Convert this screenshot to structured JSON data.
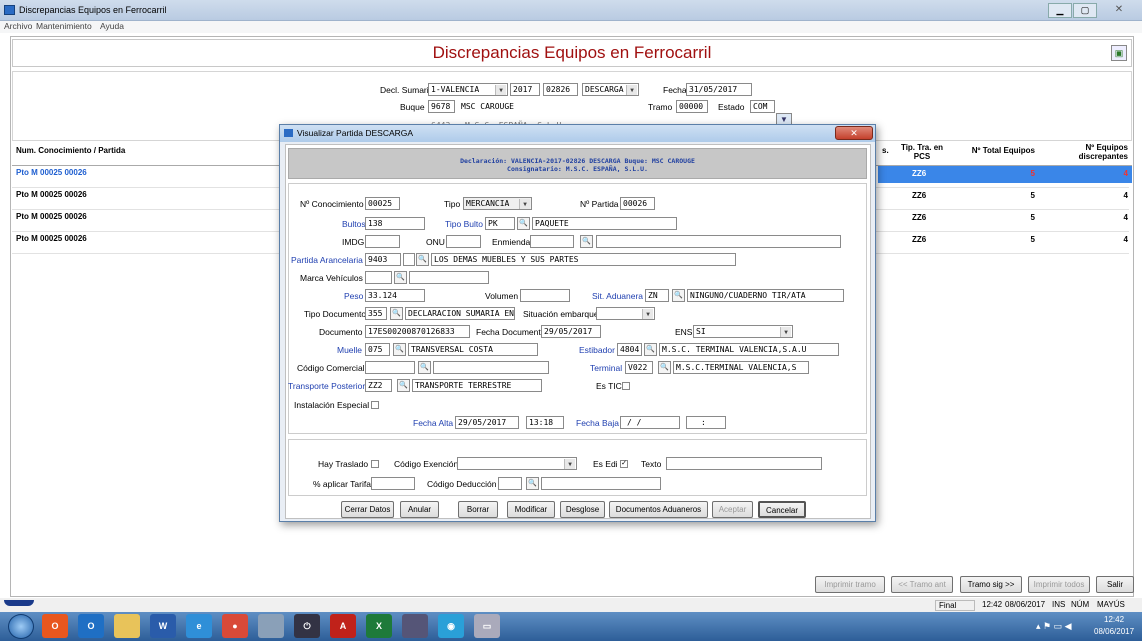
{
  "window": {
    "title": "Discrepancias Equipos en Ferrocarril"
  },
  "menu": [
    "Archivo",
    "Mantenimiento",
    "Ayuda"
  ],
  "page_title": "Discrepancias Equipos en Ferrocarril",
  "header": {
    "decl_label": "Decl. Sumaria",
    "decl_value": "1-VALENCIA",
    "year": "2017",
    "number": "02826",
    "op": "DESCARGA",
    "fecha_label": "Fecha",
    "fecha": "31/05/2017",
    "buque_label": "Buque",
    "buque_code": "9678",
    "buque_name": "MSC CAROUGE",
    "tramo_label": "Tramo",
    "tramo": "00000",
    "estado_label": "Estado",
    "estado": "COM",
    "cons_code": "6443",
    "cons_name": "M.S.C. ESPAÑA, S.L.U."
  },
  "table": {
    "col_partida": "Num. Conocimiento / Partida",
    "col_s": "s.",
    "col_tip": "Tip. Tra. en PCS",
    "col_total": "Nº Total Equipos",
    "col_disc": "Nº Equipos discrepantes",
    "rows": [
      {
        "partida": "Pto M 00025 00026",
        "tip": "ZZ6",
        "total": "5",
        "disc": "4"
      },
      {
        "partida": "Pto M 00025 00026",
        "tip": "ZZ6",
        "total": "5",
        "disc": "4"
      },
      {
        "partida": "Pto M 00025 00026",
        "tip": "ZZ6",
        "total": "5",
        "disc": "4"
      },
      {
        "partida": "Pto M 00025 00026",
        "tip": "ZZ6",
        "total": "5",
        "disc": "4"
      }
    ]
  },
  "bottom_buttons": {
    "imprimir_tramo": "Imprimir tramo",
    "tramo_ant": "<< Tramo ant",
    "tramo_sig": "Tramo sig >>",
    "imprimir_todos": "Imprimir todos",
    "salir": "Salir"
  },
  "status": {
    "final": "Final",
    "time": "12:42",
    "date": "08/06/2017",
    "ins": "INS",
    "num": "NÚM",
    "mayus": "MAYÚS"
  },
  "dialog": {
    "title": "Visualizar Partida DESCARGA",
    "banner_line1": "Declaración: VALENCIA-2017-02826 DESCARGA    Buque: MSC CAROUGE",
    "banner_line2": "Consignatario: M.S.C. ESPAÑA, S.L.U.",
    "labels": {
      "conocimiento": "Nº Conocimiento",
      "tipo": "Tipo",
      "partida": "Nº Partida",
      "bultos": "Bultos",
      "tipo_bulto": "Tipo Bulto",
      "imdg": "IMDG",
      "onu": "ONU",
      "enmienda": "Enmienda",
      "arancelaria": "Partida Arancelaria",
      "marca": "Marca Vehículos",
      "peso": "Peso",
      "volumen": "Volumen",
      "sit_aduanera": "Sit. Aduanera",
      "tipo_doc": "Tipo Documento",
      "sit_embarque": "Situación embarque",
      "documento": "Documento",
      "fecha_doc": "Fecha Documento",
      "ens": "ENS",
      "muelle": "Muelle",
      "estibador": "Estibador",
      "cod_comercial": "Código Comercial",
      "terminal": "Terminal",
      "transporte": "Transporte Posterior",
      "es_tic": "Es TIC",
      "instalacion": "Instalación Especial",
      "fecha_alta": "Fecha Alta",
      "fecha_baja": "Fecha Baja",
      "traslado": "Hay Traslado",
      "cod_exencion": "Código Exención",
      "es_edi": "Es Edi",
      "texto": "Texto",
      "aplicar_tarifa": "% aplicar Tarifa",
      "cod_deduccion": "Código Deducción"
    },
    "values": {
      "conocimiento": "00025",
      "tipo": "MERCANCIA",
      "partida": "00026",
      "bultos": "138",
      "tipo_bulto": "PK",
      "tipo_bulto_desc": "PAQUETE",
      "arancelaria": "9403",
      "arancelaria_desc": "LOS DEMAS MUEBLES Y SUS PARTES",
      "peso": "33.124",
      "sit_aduanera": "ZN",
      "sit_aduanera_desc": "NINGUNO/CUADERNO TIR/ATA",
      "tipo_doc": "355",
      "tipo_doc_desc": "DECLARACION SUMARIA ENS",
      "documento": "17ES00200870126833",
      "fecha_doc": "29/05/2017",
      "ens": "SI",
      "muelle": "075",
      "muelle_desc": "TRANSVERSAL COSTA",
      "estibador": "4804",
      "estibador_desc": "M.S.C. TERMINAL VALENCIA,S.A.U",
      "terminal": "V022",
      "terminal_desc": "M.S.C.TERMINAL VALENCIA,S",
      "transporte": "ZZ2",
      "transporte_desc": "TRANSPORTE TERRESTRE",
      "fecha_alta": "29/05/2017",
      "hora_alta": "13:18",
      "fecha_baja": "/  /",
      "hora_baja": ":"
    },
    "buttons": [
      "Cerrar Datos",
      "Anular",
      "Borrar",
      "Modificar",
      "Desglose",
      "Documentos Aduaneros",
      "Aceptar",
      "Cancelar"
    ]
  },
  "taskbar": {
    "time": "12:42",
    "date": "08/06/2017",
    "apps": [
      "O",
      "W",
      "X"
    ]
  }
}
